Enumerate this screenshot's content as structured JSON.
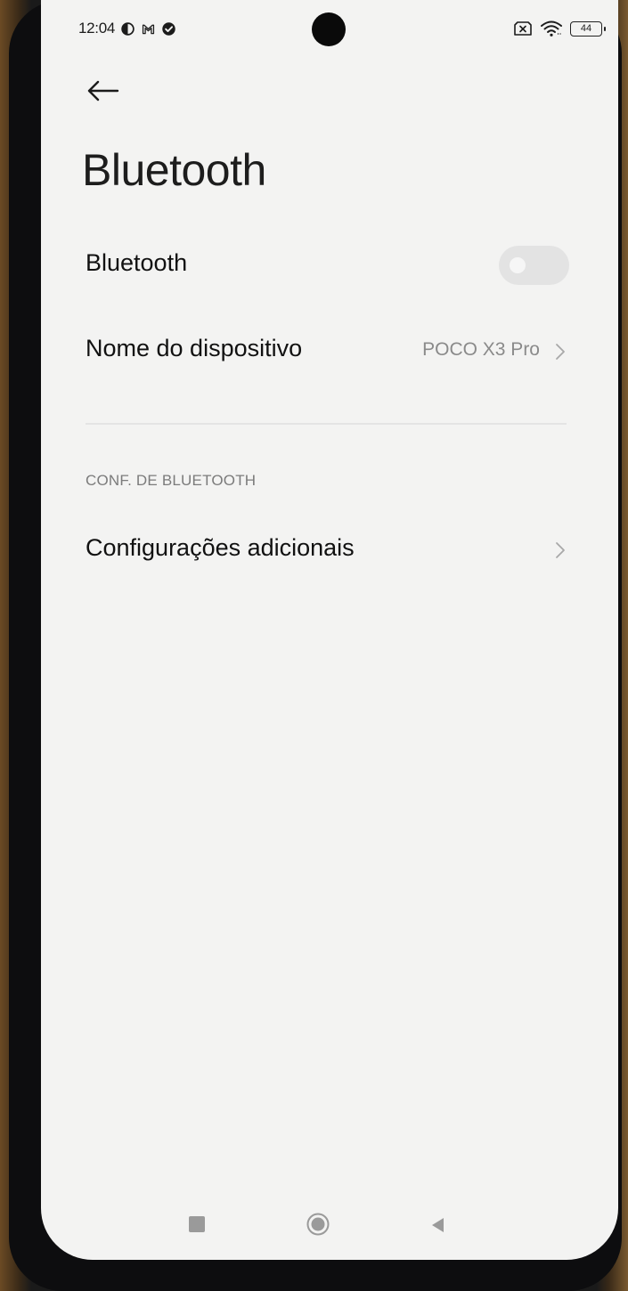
{
  "status_bar": {
    "time": "12:04",
    "battery": "44",
    "left_icons": [
      "data-saver-icon",
      "gmail-icon",
      "check-circle-icon"
    ],
    "right_icons": [
      "no-sim-icon",
      "wifi-icon",
      "battery-icon"
    ]
  },
  "header": {
    "back_icon": "arrow-left-icon",
    "title": "Bluetooth"
  },
  "settings": {
    "bluetooth_label": "Bluetooth",
    "bluetooth_enabled": false,
    "device_name_label": "Nome do dispositivo",
    "device_name_value": "POCO X3 Pro",
    "section_header": "CONF. DE BLUETOOTH",
    "additional_label": "Configurações adicionais"
  },
  "nav_bar": {
    "icons": [
      "recent-apps-icon",
      "home-icon",
      "back-triangle-icon"
    ]
  },
  "colors": {
    "screen_background": "#f3f3f2",
    "primary_text": "#111111",
    "secondary_text": "#8a8a8a",
    "toggle_off": "#e3e3e3"
  }
}
